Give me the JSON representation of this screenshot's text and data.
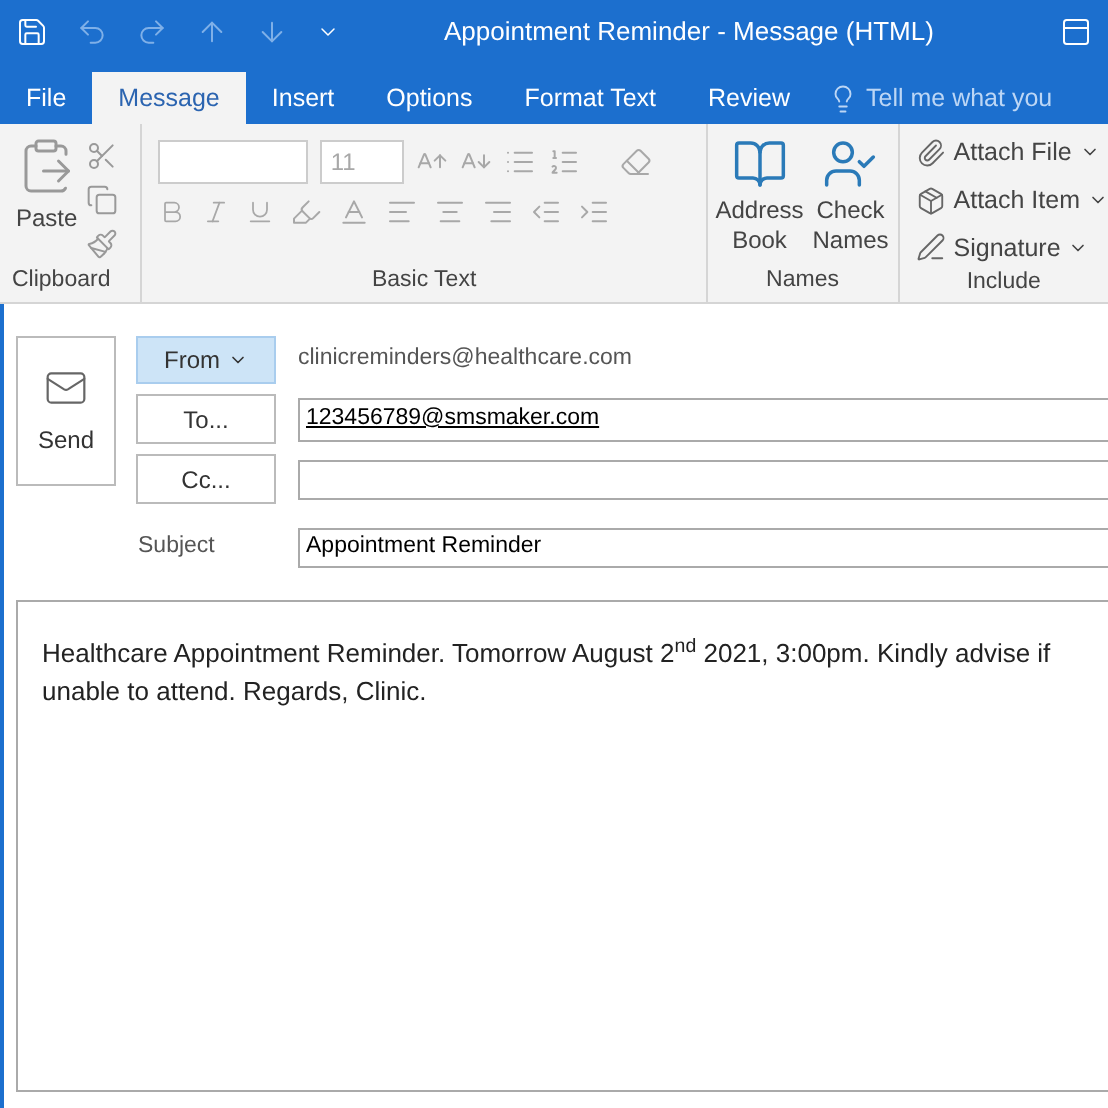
{
  "window": {
    "title": "Appointment Reminder - Message (HTML)"
  },
  "tabs": [
    {
      "label": "File",
      "selected": false
    },
    {
      "label": "Message",
      "selected": true
    },
    {
      "label": "Insert",
      "selected": false
    },
    {
      "label": "Options",
      "selected": false
    },
    {
      "label": "Format Text",
      "selected": false
    },
    {
      "label": "Review",
      "selected": false
    }
  ],
  "tell_me": {
    "placeholder": "Tell me what you"
  },
  "ribbon": {
    "clipboard": {
      "label": "Clipboard",
      "paste": "Paste"
    },
    "basic_text": {
      "label": "Basic Text",
      "font_size": "11",
      "disabled": true
    },
    "names": {
      "label": "Names",
      "buttons": [
        "Address Book",
        "Check Names"
      ]
    },
    "include": {
      "label": "Include",
      "buttons": [
        "Attach File",
        "Attach Item",
        "Signature"
      ]
    }
  },
  "send": "Send",
  "from": {
    "button": "From",
    "value": "clinicreminders@healthcare.com"
  },
  "to": {
    "button": "To...",
    "value": "123456789@smsmaker.com"
  },
  "cc": {
    "button": "Cc..."
  },
  "subject": {
    "label": "Subject",
    "value": "Appointment Reminder"
  },
  "body": "Healthcare Appointment Reminder. Tomorrow August 2$^{nd}$ 2021, 3:00pm. Kindly advise if unable to attend. Regards, Clinic."
}
